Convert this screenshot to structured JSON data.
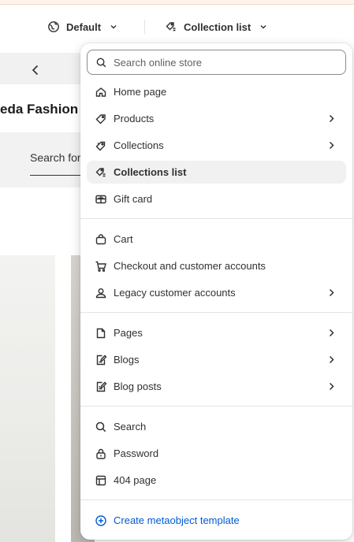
{
  "topbar": {
    "theme_label": "Default",
    "template_label": "Collection list"
  },
  "preview": {
    "store_name": "eda Fashion",
    "search_text": "Search for"
  },
  "dropdown": {
    "search_placeholder": "Search online store",
    "items": [
      {
        "label": "Home page",
        "icon": "home-icon"
      },
      {
        "label": "Products",
        "icon": "tag-icon",
        "submenu": true
      },
      {
        "label": "Collections",
        "icon": "collection-icon",
        "submenu": true
      },
      {
        "label": "Collections list",
        "icon": "collections-list-icon",
        "active": true
      },
      {
        "label": "Gift card",
        "icon": "gift-card-icon"
      },
      {
        "label": "Cart",
        "icon": "bag-icon"
      },
      {
        "label": "Checkout and customer accounts",
        "icon": "cart-icon"
      },
      {
        "label": "Legacy customer accounts",
        "icon": "person-icon",
        "submenu": true
      },
      {
        "label": "Pages",
        "icon": "page-icon",
        "submenu": true
      },
      {
        "label": "Blogs",
        "icon": "blog-icon",
        "submenu": true
      },
      {
        "label": "Blog posts",
        "icon": "blog-post-icon",
        "submenu": true
      },
      {
        "label": "Search",
        "icon": "search-icon"
      },
      {
        "label": "Password",
        "icon": "lock-icon"
      },
      {
        "label": "404 page",
        "icon": "layout-icon"
      },
      {
        "label": "Create metaobject template",
        "icon": "plus-circle-icon"
      }
    ]
  },
  "colors": {
    "link_blue": "#005bd3",
    "active_bg": "#f1f1f1",
    "text": "#303030"
  }
}
